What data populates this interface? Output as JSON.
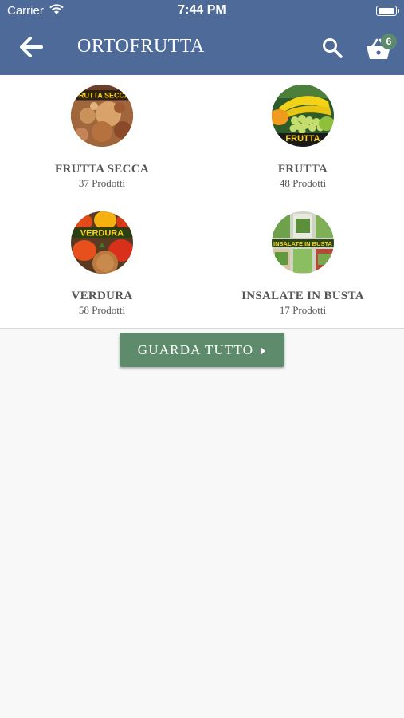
{
  "status_bar": {
    "carrier": "Carrier",
    "time": "7:44 PM"
  },
  "header": {
    "title": "ORTOFRUTTA",
    "cart_count": "6"
  },
  "categories": [
    {
      "name": "FRUTTA SECCA",
      "count": "37 Prodotti",
      "image_label": "FRUTTA SECCA"
    },
    {
      "name": "FRUTTA",
      "count": "48 Prodotti",
      "image_label": "FRUTTA"
    },
    {
      "name": "VERDURA",
      "count": "58 Prodotti",
      "image_label": "VERDURA"
    },
    {
      "name": "INSALATE IN BUSTA",
      "count": "17 Prodotti",
      "image_label": "INSALATE IN BUSTA"
    }
  ],
  "view_all_label": "GUARDA TUTTO",
  "colors": {
    "header": "#4d6a99",
    "accent": "#5e8b6c"
  }
}
